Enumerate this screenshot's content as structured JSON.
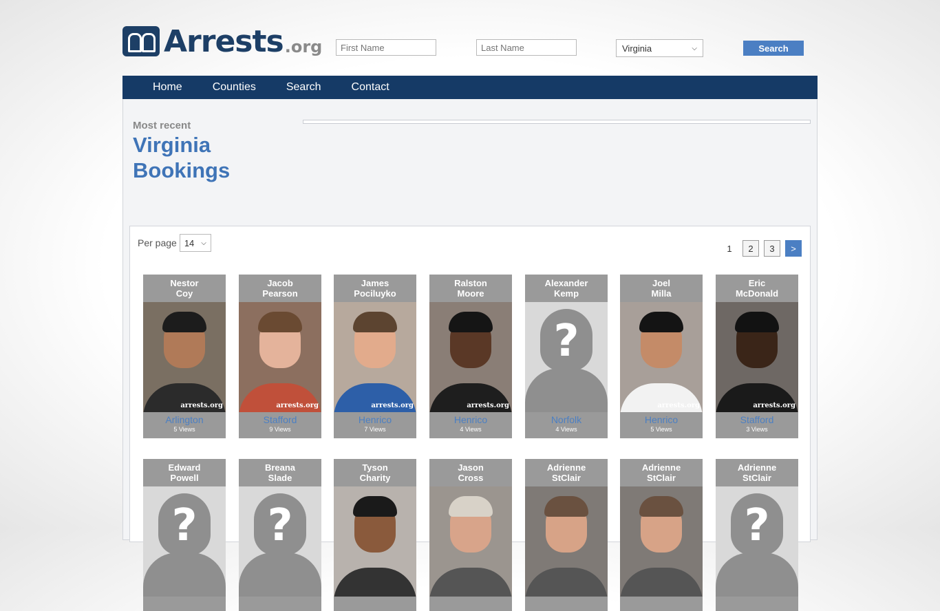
{
  "header": {
    "logo_text": "Arrests",
    "logo_suffix": ".org",
    "first_name_placeholder": "First Name",
    "last_name_placeholder": "Last Name",
    "state_selected": "Virginia",
    "search_label": "Search"
  },
  "nav": [
    "Home",
    "Counties",
    "Search",
    "Contact"
  ],
  "page": {
    "most_recent": "Most recent",
    "title_line1": "Virginia",
    "title_line2": "Bookings"
  },
  "list": {
    "per_page_label": "Per page",
    "per_page_value": "14",
    "pages": [
      "1",
      "2",
      "3"
    ],
    "next": ">"
  },
  "cards": [
    {
      "first": "Nestor",
      "last": "Coy",
      "county": "Arlington",
      "views": "5 Views",
      "photo": "person",
      "skin": "#b07a58",
      "hair": "#1c1c1c",
      "shirt": "#2b2b2b",
      "bg": "#7a6f62"
    },
    {
      "first": "Jacob",
      "last": "Pearson",
      "county": "Stafford",
      "views": "9 Views",
      "photo": "person",
      "skin": "#e4b39b",
      "hair": "#6a4a32",
      "shirt": "#c0503a",
      "bg": "#8c6f5f"
    },
    {
      "first": "James",
      "last": "Pociluyko",
      "county": "Henrico",
      "views": "7 Views",
      "photo": "person",
      "skin": "#e2ab8c",
      "hair": "#5c4430",
      "shirt": "#2d5fa8",
      "bg": "#b7a99d"
    },
    {
      "first": "Ralston",
      "last": "Moore",
      "county": "Henrico",
      "views": "4 Views",
      "photo": "person",
      "skin": "#5a3826",
      "hair": "#151515",
      "shirt": "#1e1e1e",
      "bg": "#8a7e76"
    },
    {
      "first": "Alexander",
      "last": "Kemp",
      "county": "Norfolk",
      "views": "4 Views",
      "photo": "placeholder"
    },
    {
      "first": "Joel",
      "last": "Milla",
      "county": "Henrico",
      "views": "5 Views",
      "photo": "person",
      "skin": "#c48b68",
      "hair": "#141414",
      "shirt": "#f2f2f2",
      "bg": "#a89f99"
    },
    {
      "first": "Eric",
      "last": "McDonald",
      "county": "Stafford",
      "views": "3 Views",
      "photo": "person",
      "skin": "#3a2518",
      "hair": "#121212",
      "shirt": "#1a1a1a",
      "bg": "#6e6864"
    },
    {
      "first": "Edward",
      "last": "Powell",
      "county": "",
      "views": "",
      "photo": "placeholder"
    },
    {
      "first": "Breana",
      "last": "Slade",
      "county": "",
      "views": "",
      "photo": "placeholder"
    },
    {
      "first": "Tyson",
      "last": "Charity",
      "county": "",
      "views": "",
      "photo": "person",
      "skin": "#8a5a3c",
      "hair": "#1a1a1a",
      "shirt": "#333333",
      "bg": "#b8b2ad"
    },
    {
      "first": "Jason",
      "last": "Cross",
      "county": "",
      "views": "",
      "photo": "person",
      "skin": "#d8a48a",
      "hair": "#d8d2c8",
      "shirt": "#555555",
      "bg": "#9b958f"
    },
    {
      "first": "Adrienne",
      "last": "StClair",
      "county": "",
      "views": "",
      "photo": "person",
      "skin": "#d7a387",
      "hair": "#6a5140",
      "shirt": "#555555",
      "bg": "#7f7a76"
    },
    {
      "first": "Adrienne",
      "last": "StClair",
      "county": "",
      "views": "",
      "photo": "person",
      "skin": "#d7a387",
      "hair": "#6a5140",
      "shirt": "#555555",
      "bg": "#7f7a76"
    },
    {
      "first": "Adrienne",
      "last": "StClair",
      "county": "",
      "views": "",
      "photo": "placeholder"
    }
  ]
}
